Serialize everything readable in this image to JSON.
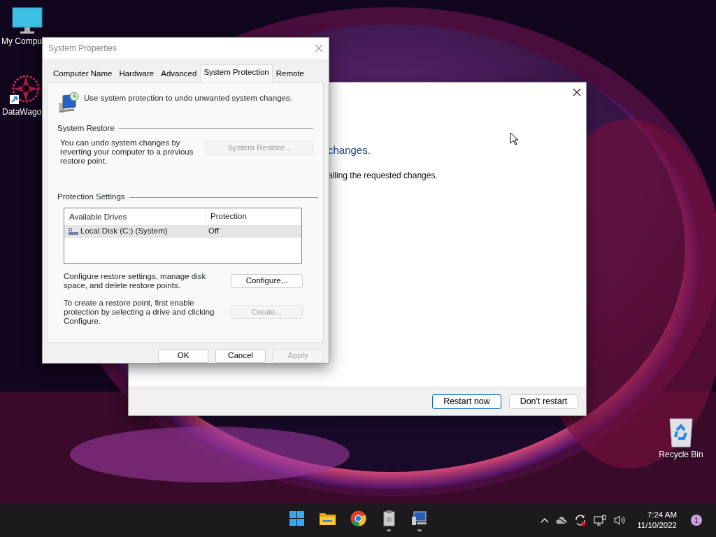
{
  "desktop_icons": [
    {
      "label": "My Compu",
      "kind": "monitor"
    },
    {
      "label": "DataWago",
      "kind": "app"
    },
    {
      "label": "Recycle Bin",
      "kind": "recycle"
    }
  ],
  "restart_window": {
    "heading": "changes.",
    "message": "alling the requested changes.",
    "buttons": [
      {
        "label": "Restart now",
        "default": true
      },
      {
        "label": "Don't restart",
        "default": false
      }
    ]
  },
  "system_properties": {
    "title": "System Properties",
    "tabs": [
      {
        "label": "Computer Name",
        "selected": false
      },
      {
        "label": "Hardware",
        "selected": false
      },
      {
        "label": "Advanced",
        "selected": false
      },
      {
        "label": "System Protection",
        "selected": true
      },
      {
        "label": "Remote",
        "selected": false
      }
    ],
    "intro": "Use system protection to undo unwanted system changes.",
    "system_restore": {
      "title": "System Restore",
      "text": "You can undo system changes by reverting your computer to a previous restore point.",
      "button": {
        "label": "System Restore...",
        "disabled": true
      }
    },
    "protection_settings": {
      "title": "Protection Settings",
      "columns": [
        "Available Drives",
        "Protection"
      ],
      "rows": [
        {
          "drive": "Local Disk (C:) (System)",
          "protection": "Off",
          "selected": true
        }
      ],
      "configure": {
        "text": "Configure restore settings, manage disk space, and delete restore points.",
        "button": {
          "label": "Configure...",
          "disabled": false
        }
      },
      "create": {
        "text": "To create a restore point, first enable protection by selecting a drive and clicking Configure.",
        "button": {
          "label": "Create...",
          "disabled": true
        }
      }
    },
    "buttons": [
      {
        "label": "OK",
        "disabled": false
      },
      {
        "label": "Cancel",
        "disabled": false
      },
      {
        "label": "Apply",
        "disabled": true
      }
    ]
  },
  "taskbar": {
    "apps": [
      {
        "kind": "start",
        "running": false
      },
      {
        "kind": "folder",
        "running": false
      },
      {
        "kind": "browser",
        "running": false
      },
      {
        "kind": "clipboard",
        "running": true
      },
      {
        "kind": "computer",
        "running": true
      }
    ],
    "time": "7:24 AM",
    "date": "11/10/2022",
    "notifications": "1"
  }
}
